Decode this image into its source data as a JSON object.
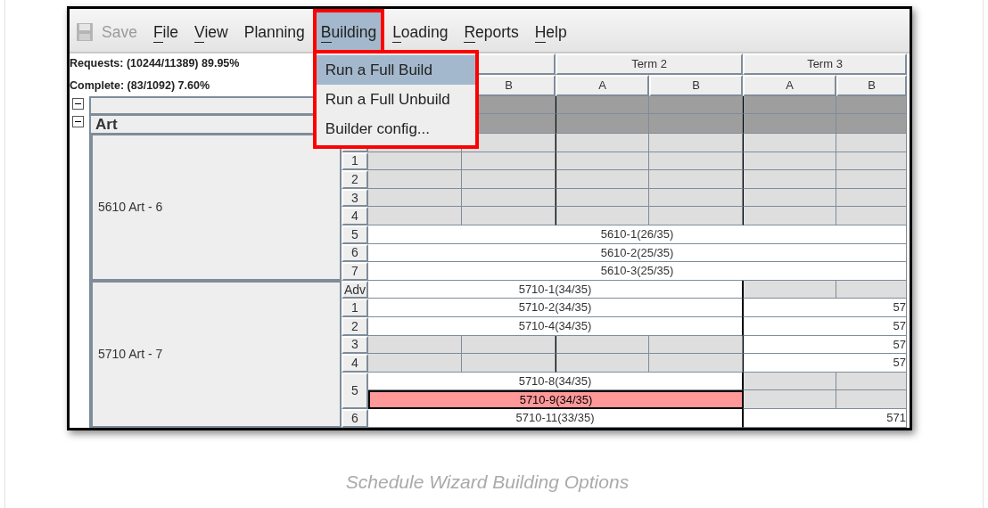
{
  "menubar": [
    {
      "label": "Save",
      "kind": "save",
      "disabled": true,
      "mnemonic": false,
      "selected": false
    },
    {
      "label": "File",
      "kind": "menu",
      "disabled": false,
      "mnemonic": true,
      "selected": false
    },
    {
      "label": "View",
      "kind": "menu",
      "disabled": false,
      "mnemonic": true,
      "selected": false
    },
    {
      "label": "Planning",
      "kind": "menu",
      "disabled": false,
      "mnemonic": false,
      "selected": false
    },
    {
      "label": "Building",
      "kind": "menu",
      "disabled": false,
      "mnemonic": true,
      "selected": true
    },
    {
      "label": "Loading",
      "kind": "menu",
      "disabled": false,
      "mnemonic": true,
      "selected": false
    },
    {
      "label": "Reports",
      "kind": "menu",
      "disabled": false,
      "mnemonic": true,
      "selected": false
    },
    {
      "label": "Help",
      "kind": "menu",
      "disabled": false,
      "mnemonic": true,
      "selected": false
    }
  ],
  "dropdown": [
    {
      "label": "Run a Full Build",
      "selected": true
    },
    {
      "label": "Run a Full Unbuild",
      "selected": false
    },
    {
      "label": "Builder config...",
      "selected": false
    }
  ],
  "stats": [
    "Requests: (10244/11389) 89.95%",
    "Complete: (83/1092) 7.60%"
  ],
  "terms": [
    "Term 2",
    "Term 3"
  ],
  "subheaders": [
    "B",
    "A",
    "B",
    "A",
    "B"
  ],
  "tree": {
    "expanded": true,
    "children": [
      {
        "label": "Art",
        "expanded": true,
        "courses": [
          {
            "label": "5610 Art - 6",
            "periods": [
              {
                "lines": [
                  [
                    {
                      "kind": "open"
                    },
                    {
                      "kind": "open"
                    },
                    {
                      "kind": "open"
                    },
                    {
                      "kind": "open"
                    },
                    {
                      "kind": "open"
                    },
                    {
                      "kind": "open"
                    }
                  ]
                ]
              },
              {
                "label": "1",
                "lines": [
                  [
                    {
                      "kind": "open"
                    },
                    {
                      "kind": "open"
                    },
                    {
                      "kind": "open"
                    },
                    {
                      "kind": "open"
                    },
                    {
                      "kind": "open"
                    },
                    {
                      "kind": "open"
                    }
                  ]
                ]
              },
              {
                "label": "2",
                "lines": [
                  [
                    {
                      "kind": "open"
                    },
                    {
                      "kind": "open"
                    },
                    {
                      "kind": "open"
                    },
                    {
                      "kind": "open"
                    },
                    {
                      "kind": "open"
                    },
                    {
                      "kind": "open"
                    }
                  ]
                ]
              },
              {
                "label": "3",
                "lines": [
                  [
                    {
                      "kind": "open"
                    },
                    {
                      "kind": "open"
                    },
                    {
                      "kind": "open"
                    },
                    {
                      "kind": "open"
                    },
                    {
                      "kind": "open"
                    },
                    {
                      "kind": "open"
                    }
                  ]
                ]
              },
              {
                "label": "4",
                "lines": [
                  [
                    {
                      "kind": "open"
                    },
                    {
                      "kind": "open"
                    },
                    {
                      "kind": "open"
                    },
                    {
                      "kind": "open"
                    },
                    {
                      "kind": "open"
                    },
                    {
                      "kind": "open"
                    }
                  ]
                ]
              },
              {
                "label": "5",
                "lines": [
                  [
                    {
                      "kind": "year",
                      "text": "5610-1(26/35)",
                      "selected": false
                    }
                  ]
                ]
              },
              {
                "label": "6",
                "lines": [
                  [
                    {
                      "kind": "year",
                      "text": "5610-2(25/35)",
                      "selected": false
                    }
                  ]
                ]
              },
              {
                "label": "7",
                "lines": [
                  [
                    {
                      "kind": "year",
                      "text": "5610-3(25/35)",
                      "selected": false
                    }
                  ]
                ]
              }
            ]
          },
          {
            "label": "5710 Art - 7",
            "periods": [
              {
                "label": "Adv",
                "lines": [
                  [
                    {
                      "kind": "semester",
                      "text": "5710-1(34/35)",
                      "selected": false
                    },
                    {
                      "kind": "open"
                    },
                    {
                      "kind": "open"
                    }
                  ]
                ]
              },
              {
                "label": "1",
                "lines": [
                  [
                    {
                      "kind": "semester",
                      "text": "5710-2(34/35)",
                      "selected": false
                    },
                    {
                      "kind": "term",
                      "text": "57",
                      "selected": false
                    }
                  ]
                ]
              },
              {
                "label": "2",
                "lines": [
                  [
                    {
                      "kind": "semester",
                      "text": "5710-4(34/35)",
                      "selected": false
                    },
                    {
                      "kind": "term",
                      "text": "57",
                      "selected": false
                    }
                  ]
                ]
              },
              {
                "label": "3",
                "lines": [
                  [
                    {
                      "kind": "open"
                    },
                    {
                      "kind": "open"
                    },
                    {
                      "kind": "open"
                    },
                    {
                      "kind": "open"
                    },
                    {
                      "kind": "term",
                      "text": "57",
                      "selected": false
                    }
                  ]
                ]
              },
              {
                "label": "4",
                "lines": [
                  [
                    {
                      "kind": "open"
                    },
                    {
                      "kind": "open"
                    },
                    {
                      "kind": "open"
                    },
                    {
                      "kind": "open"
                    },
                    {
                      "kind": "term",
                      "text": "57",
                      "selected": false
                    }
                  ]
                ]
              },
              {
                "label": "5",
                "lines": [
                  [
                    {
                      "kind": "semester",
                      "text": "5710-8(34/35)",
                      "selected": false
                    },
                    {
                      "kind": "open"
                    },
                    {
                      "kind": "open"
                    }
                  ],
                  [
                    {
                      "kind": "semester",
                      "text": "5710-9(34/35)",
                      "selected": true
                    },
                    {
                      "kind": "open"
                    },
                    {
                      "kind": "open"
                    }
                  ]
                ]
              },
              {
                "label": "6",
                "lines": [
                  [
                    {
                      "kind": "semester",
                      "text": "5710-11(33/35)",
                      "selected": false
                    },
                    {
                      "kind": "term",
                      "text": "571",
                      "selected": false
                    }
                  ]
                ]
              }
            ]
          }
        ]
      }
    ]
  },
  "caption": "Schedule Wizard Building Options"
}
